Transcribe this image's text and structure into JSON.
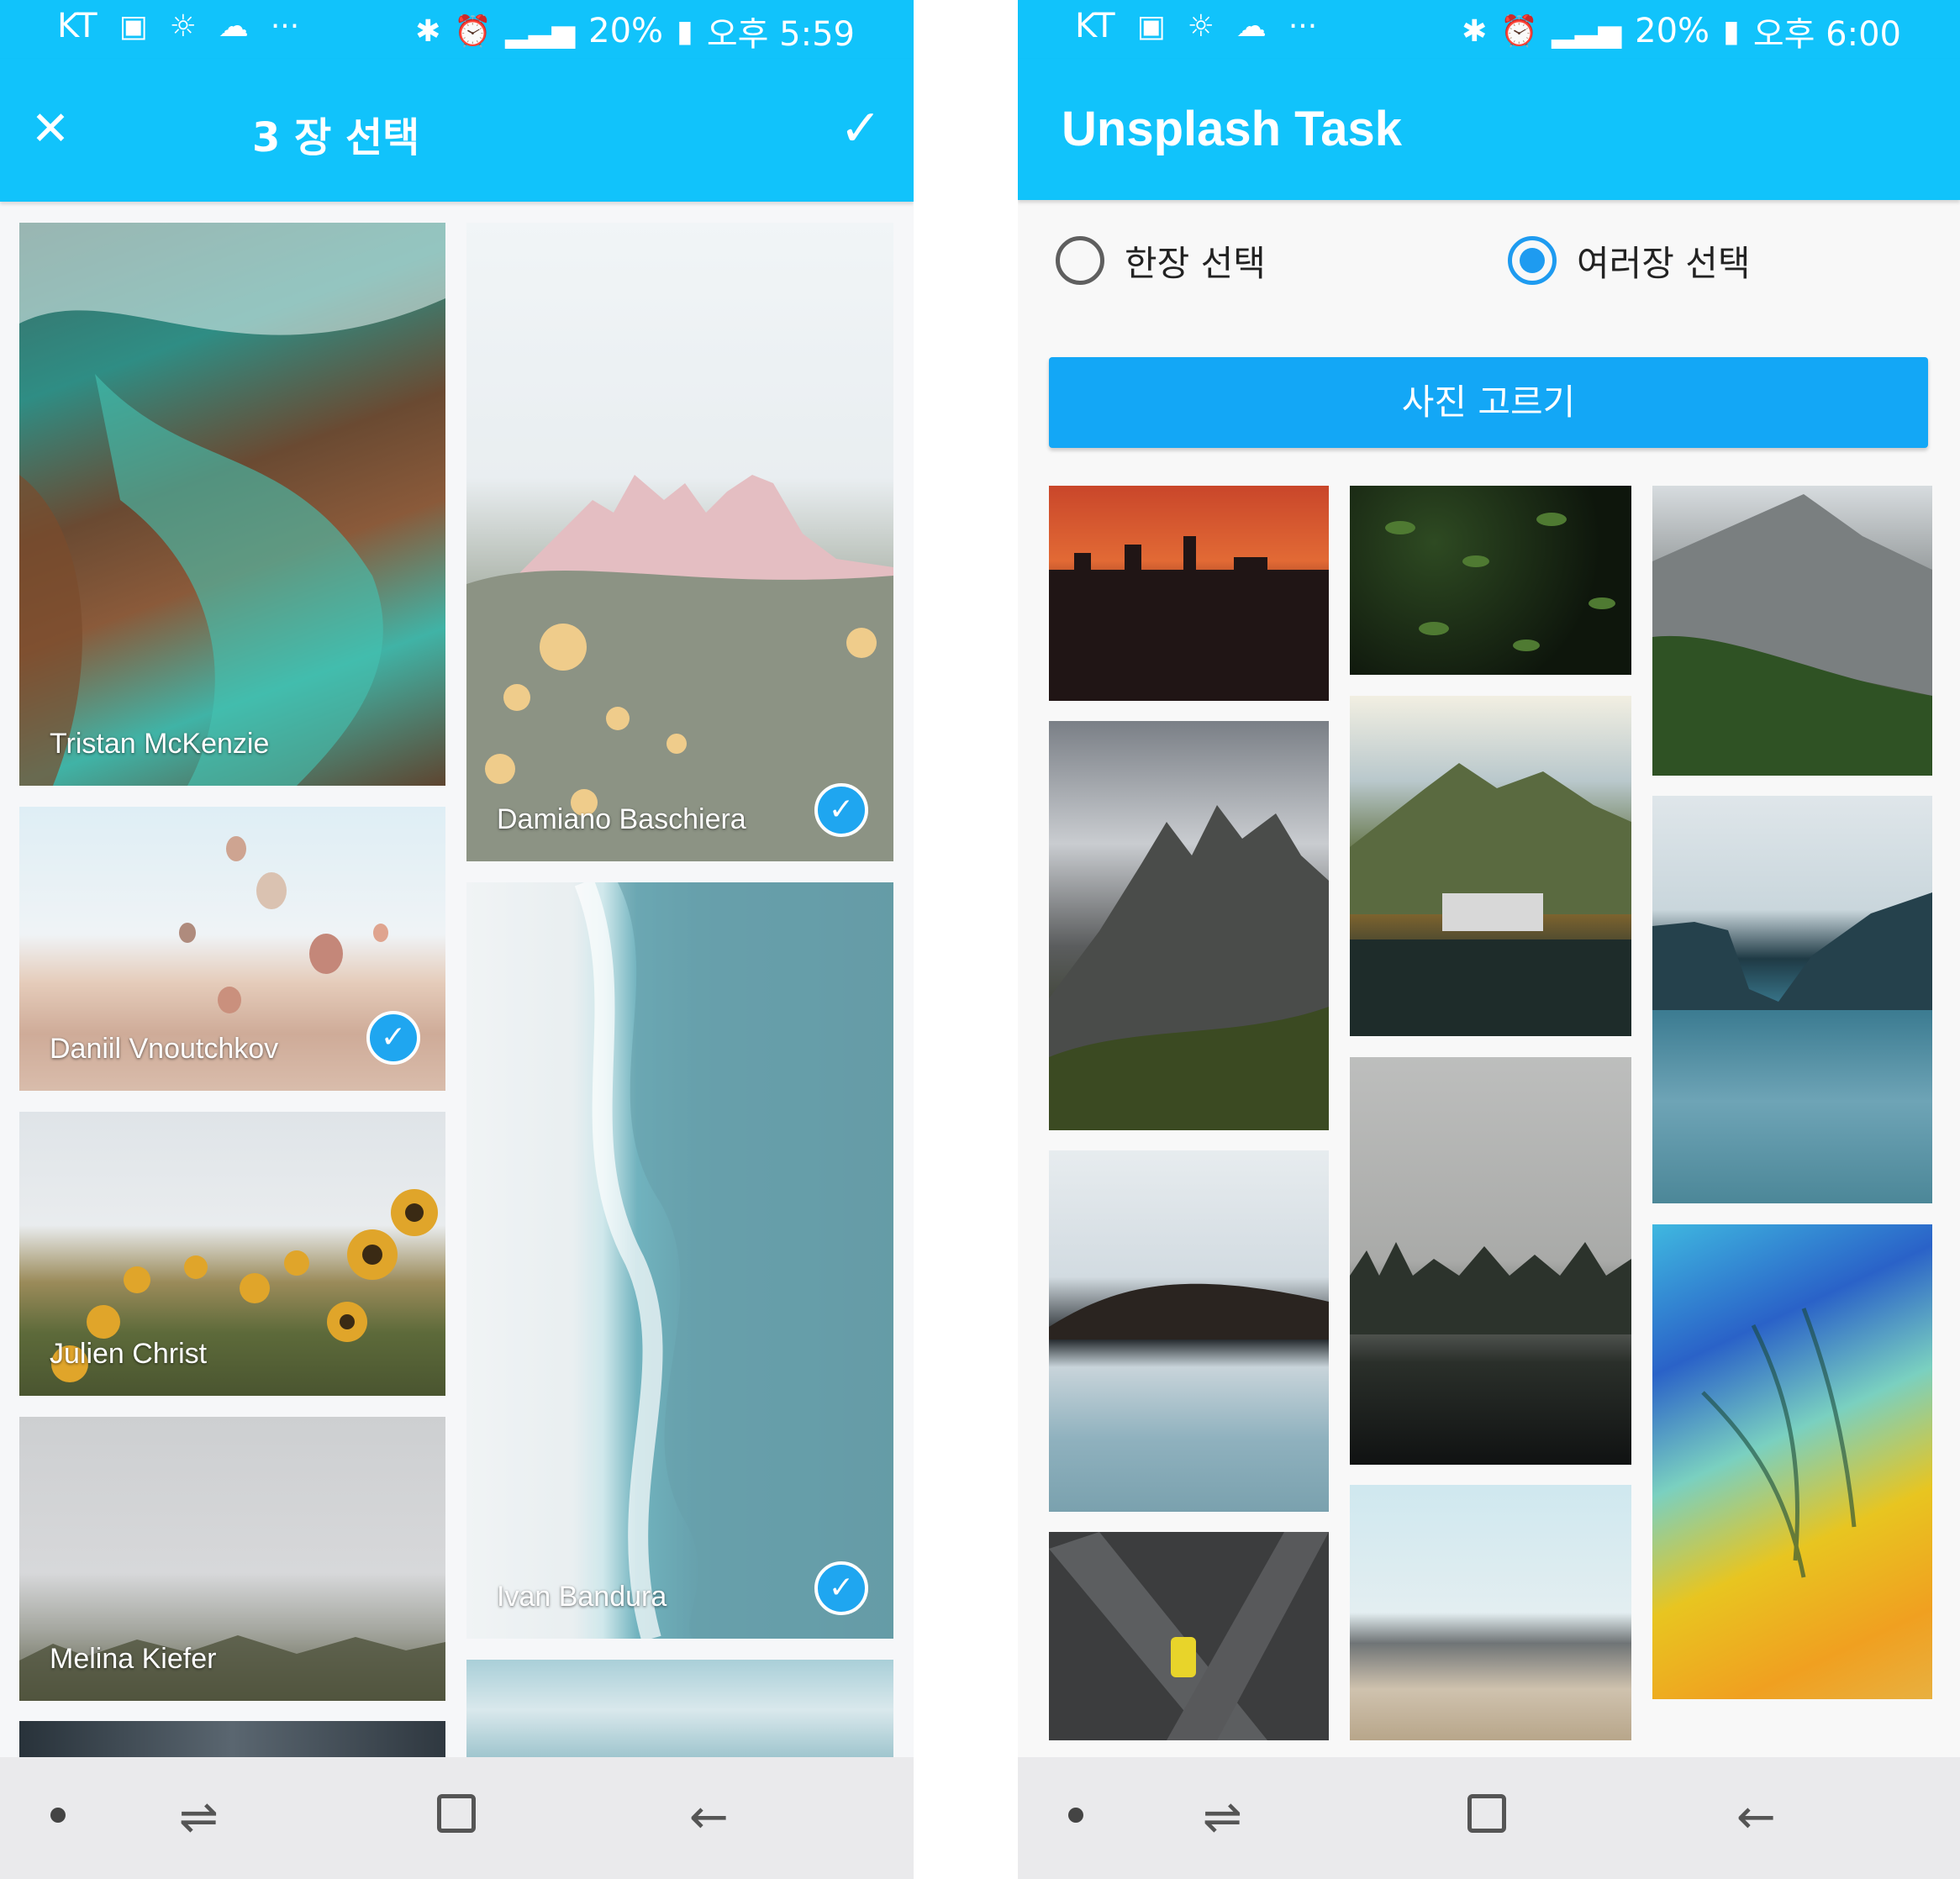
{
  "left": {
    "status": {
      "carrier": "KT",
      "battery": "20%",
      "time": "오후 5:59"
    },
    "appbar": {
      "title": "3 장 선택"
    },
    "photos": [
      {
        "author": "Tristan McKenzie",
        "selected": false
      },
      {
        "author": "Daniil Vnoutchkov",
        "selected": true
      },
      {
        "author": "Julien Christ",
        "selected": false
      },
      {
        "author": "Melina Kiefer",
        "selected": false
      },
      {
        "author": "Damiano Baschiera",
        "selected": true
      },
      {
        "author": "Ivan Bandura",
        "selected": true
      }
    ]
  },
  "right": {
    "status": {
      "carrier": "KT",
      "battery": "20%",
      "time": "오후 6:00"
    },
    "appbar": {
      "title": "Unsplash Task"
    },
    "options": {
      "single": "한장 선택",
      "multiple": "여러장 선택",
      "selected": "multiple"
    },
    "pick_button": "사진 고르기"
  },
  "icons": {
    "close": "close-icon",
    "confirm": "check-icon",
    "selected": "check-circle-icon"
  },
  "colors": {
    "appbar": "#11c3fb",
    "button": "#13a7f6",
    "radio_on": "#1e9bf0",
    "badge": "#1fa6f0"
  }
}
